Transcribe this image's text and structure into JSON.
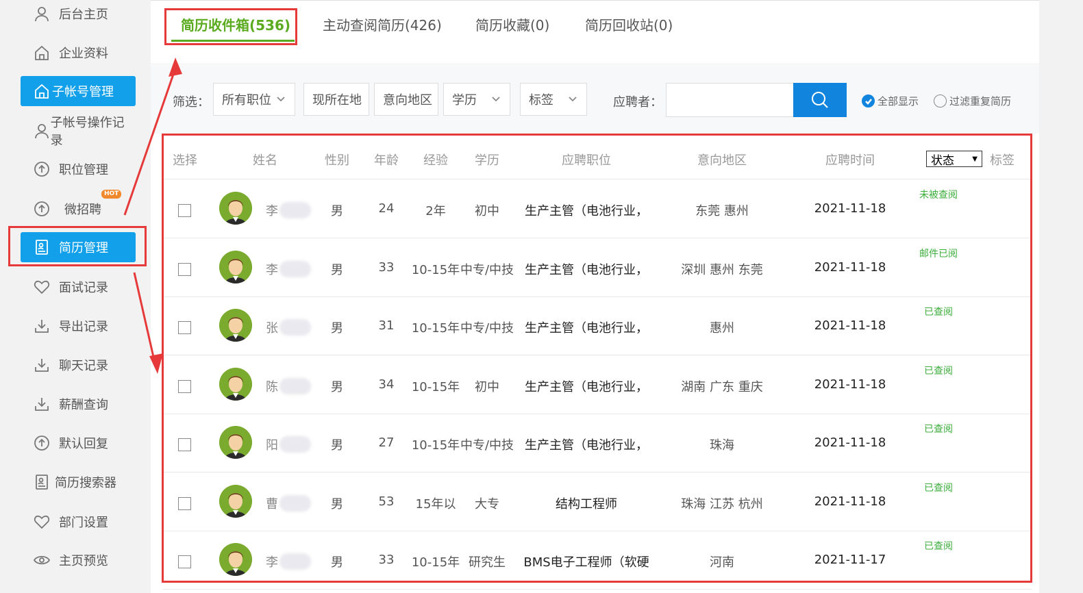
{
  "sidebar": {
    "items": [
      {
        "label": "后台主页",
        "icon": "user-icon"
      },
      {
        "label": "企业资料",
        "icon": "home-icon"
      },
      {
        "label": "子帐号管理",
        "icon": "home-icon"
      },
      {
        "label": "子帐号操作记录",
        "icon": "user-icon"
      },
      {
        "label": "职位管理",
        "icon": "upload-icon"
      },
      {
        "label": "微招聘",
        "icon": "upload-icon",
        "badge": "HOT"
      },
      {
        "label": "简历管理",
        "icon": "resume-icon"
      },
      {
        "label": "面试记录",
        "icon": "heart-icon"
      },
      {
        "label": "导出记录",
        "icon": "download-icon"
      },
      {
        "label": "聊天记录",
        "icon": "download-icon"
      },
      {
        "label": "薪酬查询",
        "icon": "download-icon"
      },
      {
        "label": "默认回复",
        "icon": "upload-icon"
      },
      {
        "label": "简历搜索器",
        "icon": "resume-icon"
      },
      {
        "label": "部门设置",
        "icon": "heart-icon"
      },
      {
        "label": "主页预览",
        "icon": "eye-icon"
      }
    ]
  },
  "tabs": [
    {
      "label": "简历收件箱(536)",
      "active": true
    },
    {
      "label": "主动查阅简历(426)",
      "active": false
    },
    {
      "label": "简历收藏(0)",
      "active": false
    },
    {
      "label": "简历回收站(0)",
      "active": false
    }
  ],
  "filter": {
    "label": "筛选：",
    "position": "所有职位",
    "location": "现所在地",
    "intent_area": "意向地区",
    "education": "学历",
    "tag": "标签",
    "applicant_label": "应聘者：",
    "applicant_value": "",
    "show_all": "全部显示",
    "filter_dup": "过滤重复简历"
  },
  "table": {
    "headers": {
      "select": "选择",
      "name": "姓名",
      "gender": "性别",
      "age": "年龄",
      "experience": "经验",
      "education": "学历",
      "position": "应聘职位",
      "area": "意向地区",
      "time": "应聘时间",
      "status": "状态",
      "tag": "标签"
    },
    "rows": [
      {
        "name": "李",
        "gender": "男",
        "age": "24",
        "exp": "2年",
        "edu": "初中",
        "position": "生产主管（电池行业，",
        "area": "东莞 惠州",
        "time": "2021-11-18",
        "status": "未被查阅"
      },
      {
        "name": "李",
        "gender": "男",
        "age": "33",
        "exp": "10-15年",
        "edu": "中专/中技",
        "position": "生产主管（电池行业，",
        "area": "深圳 惠州 东莞",
        "time": "2021-11-18",
        "status": "邮件已阅"
      },
      {
        "name": "张",
        "gender": "男",
        "age": "31",
        "exp": "10-15年",
        "edu": "中专/中技",
        "position": "生产主管（电池行业，",
        "area": "惠州",
        "time": "2021-11-18",
        "status": "已查阅"
      },
      {
        "name": "陈",
        "gender": "男",
        "age": "34",
        "exp": "10-15年",
        "edu": "初中",
        "position": "生产主管（电池行业，",
        "area": "湖南 广东 重庆",
        "time": "2021-11-18",
        "status": "已查阅"
      },
      {
        "name": "阳",
        "gender": "男",
        "age": "27",
        "exp": "10-15年",
        "edu": "中专/中技",
        "position": "生产主管（电池行业，",
        "area": "珠海",
        "time": "2021-11-18",
        "status": "已查阅"
      },
      {
        "name": "曹",
        "gender": "男",
        "age": "53",
        "exp": "15年以",
        "edu": "大专",
        "position": "结构工程师",
        "area": "珠海 江苏 杭州",
        "time": "2021-11-18",
        "status": "已查阅"
      },
      {
        "name": "李",
        "gender": "男",
        "age": "33",
        "exp": "10-15年",
        "edu": "研究生",
        "position": "BMS电子工程师（软硬",
        "area": "河南",
        "time": "2021-11-17",
        "status": "已查阅"
      }
    ]
  },
  "colors": {
    "accent_green": "#5aab1f",
    "active_blue": "#11a0e9",
    "search_blue": "#1185de",
    "annotation_red": "#e63a3a",
    "status_green": "#3cae3c"
  }
}
